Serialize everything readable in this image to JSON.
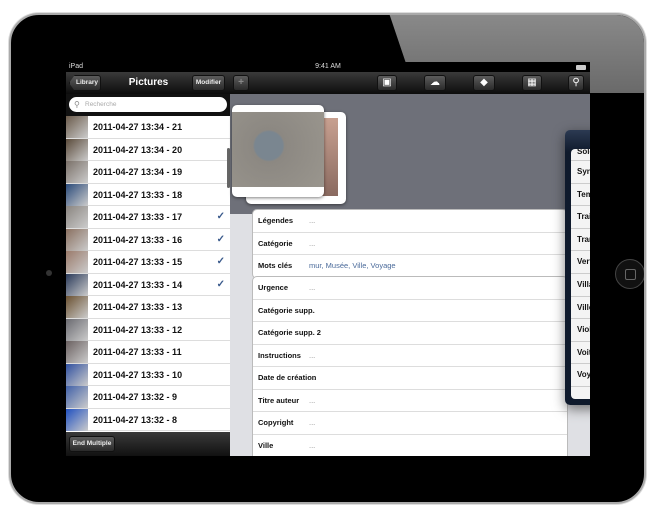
{
  "status": {
    "device": "iPad",
    "time": "9:41 AM"
  },
  "toolbar": {
    "back": "Library",
    "title": "Pictures",
    "edit": "Modifier",
    "add": "+",
    "icons": [
      "photo-folder-icon",
      "cloud-upload-icon",
      "tag-icon",
      "calendar-icon",
      "key-icon"
    ]
  },
  "search": {
    "placeholder": "Recherche"
  },
  "list": [
    {
      "label": "2011-04-27 13:34 - 21",
      "checked": false,
      "color": "#6a5a4a"
    },
    {
      "label": "2011-04-27 13:34 - 20",
      "checked": false,
      "color": "#5a4a3a"
    },
    {
      "label": "2011-04-27 13:34 - 19",
      "checked": false,
      "color": "#7a7068"
    },
    {
      "label": "2011-04-27 13:33 - 18",
      "checked": false,
      "color": "#2a4a7a"
    },
    {
      "label": "2011-04-27 13:33 - 17",
      "checked": true,
      "color": "#8a8580"
    },
    {
      "label": "2011-04-27 13:33 - 16",
      "checked": true,
      "color": "#8a7060"
    },
    {
      "label": "2011-04-27 13:33 - 15",
      "checked": true,
      "color": "#9a7a6a"
    },
    {
      "label": "2011-04-27 13:33 - 14",
      "checked": true,
      "color": "#2a3a5a"
    },
    {
      "label": "2011-04-27 13:33 - 13",
      "checked": false,
      "color": "#6a5030"
    },
    {
      "label": "2011-04-27 13:33 - 12",
      "checked": false,
      "color": "#6a6a70"
    },
    {
      "label": "2011-04-27 13:33 - 11",
      "checked": false,
      "color": "#6a6060"
    },
    {
      "label": "2011-04-27 13:33 - 10",
      "checked": false,
      "color": "#3050a0"
    },
    {
      "label": "2011-04-27 13:32 - 9",
      "checked": false,
      "color": "#4060a8"
    },
    {
      "label": "2011-04-27 13:32 - 8",
      "checked": false,
      "color": "#2050c0"
    }
  ],
  "bottom": {
    "end_multiple": "End Multiple"
  },
  "fields1": [
    {
      "label": "Légendes",
      "value": "..."
    },
    {
      "label": "Catégorie",
      "value": "..."
    },
    {
      "label": "Mots clés",
      "value": "mur, Musée, Ville, Voyage"
    }
  ],
  "fields2": [
    {
      "label": "Urgence",
      "value": "..."
    },
    {
      "label": "Catégorie supp.",
      "value": "..."
    },
    {
      "label": "Catégorie supp. 2",
      "value": "..."
    },
    {
      "label": "Instructions",
      "value": "..."
    },
    {
      "label": "Date de création",
      "value": "..."
    },
    {
      "label": "Titre auteur",
      "value": "..."
    },
    {
      "label": "Copyright",
      "value": "..."
    },
    {
      "label": "Ville",
      "value": "..."
    }
  ],
  "keywords": [
    {
      "label": "Soleil",
      "checked": false
    },
    {
      "label": "Synagogue",
      "checked": false
    },
    {
      "label": "Temple",
      "checked": false
    },
    {
      "label": "Train",
      "checked": false
    },
    {
      "label": "Transports",
      "checked": false
    },
    {
      "label": "Vert",
      "checked": false
    },
    {
      "label": "Village",
      "checked": false
    },
    {
      "label": "Ville",
      "checked": true
    },
    {
      "label": "Violet",
      "checked": false
    },
    {
      "label": "Voiture",
      "checked": false
    },
    {
      "label": "Voyage",
      "checked": true
    }
  ],
  "colors": {
    "accent_check": "#3a5a8c",
    "toolbar": "#1a1a1a"
  }
}
